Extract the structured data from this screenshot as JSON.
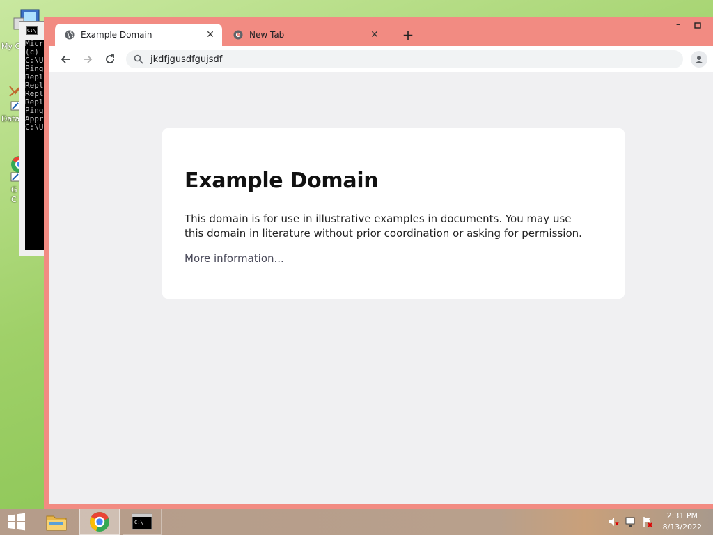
{
  "desktop": {
    "icons": [
      {
        "label": "My C",
        "icon": "computer-icon"
      },
      {
        "label": "Data",
        "icon": "shortcut-icon"
      },
      {
        "label": "G\nC",
        "icon": "chrome-shortcut-icon"
      }
    ]
  },
  "console": {
    "lines": [
      "Micr",
      "(c)",
      "",
      "C:\\U",
      "",
      "Ping",
      "Repl",
      "Repl",
      "Repl",
      "Repl",
      "",
      "Ping",
      "",
      "Appr",
      "",
      "C:\\U"
    ]
  },
  "browser": {
    "tabs": [
      {
        "title": "Example Domain",
        "active": true,
        "icon": "globe-icon"
      },
      {
        "title": "New Tab",
        "active": false,
        "icon": "chrome-icon"
      }
    ],
    "new_tab_label": "+",
    "address": "jkdfjgusdfgujsdf",
    "accent_color": "#f28b82"
  },
  "page": {
    "heading": "Example Domain",
    "body": "This domain is for use in illustrative examples in documents. You may use this domain in literature without prior coordination or asking for permission.",
    "link": "More information..."
  },
  "taskbar": {
    "time": "2:31 PM",
    "date": "8/13/2022",
    "items": [
      "start-icon",
      "file-explorer-icon",
      "chrome-icon",
      "cmd-icon"
    ]
  }
}
